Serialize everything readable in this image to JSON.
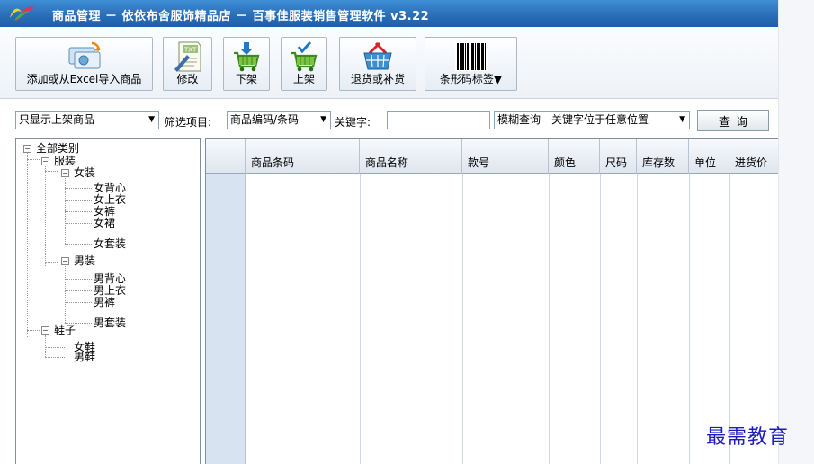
{
  "window": {
    "title": "商品管理 － 依依布舍服饰精品店 － 百事佳服装销售管理软件 v3.22",
    "logo_icon": "butterfly-logo-icon"
  },
  "toolbar": {
    "buttons": [
      {
        "label": "添加或从Excel导入商品",
        "icon": "import-goods-icon"
      },
      {
        "label": "修改",
        "icon": "edit-txt-icon"
      },
      {
        "label": "下架",
        "icon": "cart-down-arrow-icon"
      },
      {
        "label": "上架",
        "icon": "cart-check-icon"
      },
      {
        "label": "退货或补货",
        "icon": "basket-icon"
      },
      {
        "label": "条形码标签▼",
        "icon": "barcode-icon"
      }
    ]
  },
  "filter": {
    "status_select": "只显示上架商品",
    "filter_label": "筛选项目:",
    "field_select": "商品编码/条码",
    "keyword_label": "关键字:",
    "keyword_value": "",
    "match_select": "模糊查询 - 关键字位于任意位置",
    "query_button": "查询"
  },
  "tree": {
    "root": "全部类别",
    "categories": [
      {
        "label": "服装",
        "groups": [
          {
            "label": "女装",
            "items": [
              "女背心",
              "女上衣",
              "女裤",
              "女裙",
              "女套装"
            ]
          },
          {
            "label": "男装",
            "items": [
              "男背心",
              "男上衣",
              "男裤",
              "男套装"
            ]
          }
        ]
      },
      {
        "label": "鞋子",
        "items": [
          "女鞋",
          "男鞋"
        ]
      }
    ]
  },
  "table": {
    "columns": [
      "商品条码",
      "商品名称",
      "款号",
      "颜色",
      "尺码",
      "库存数",
      "单位",
      "进货价"
    ],
    "rows": []
  },
  "watermark": "最需教育",
  "colors": {
    "titlebar": "#2a6fb8",
    "row_indicator": "#d7e3f0",
    "watermark": "#1c1cc0"
  }
}
